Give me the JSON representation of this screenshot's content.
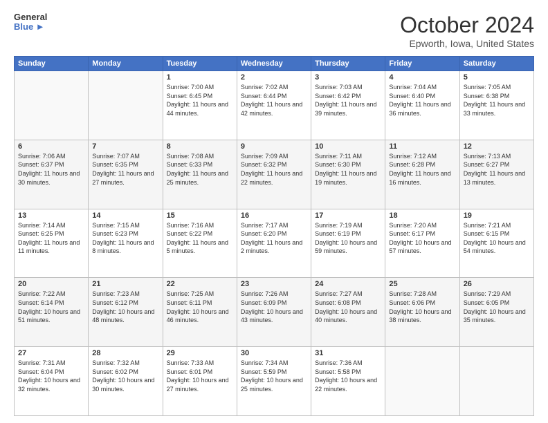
{
  "header": {
    "logo_line1": "General",
    "logo_line2": "Blue",
    "month": "October 2024",
    "location": "Epworth, Iowa, United States"
  },
  "weekdays": [
    "Sunday",
    "Monday",
    "Tuesday",
    "Wednesday",
    "Thursday",
    "Friday",
    "Saturday"
  ],
  "weeks": [
    [
      {
        "day": "",
        "sunrise": "",
        "sunset": "",
        "daylight": ""
      },
      {
        "day": "",
        "sunrise": "",
        "sunset": "",
        "daylight": ""
      },
      {
        "day": "1",
        "sunrise": "Sunrise: 7:00 AM",
        "sunset": "Sunset: 6:45 PM",
        "daylight": "Daylight: 11 hours and 44 minutes."
      },
      {
        "day": "2",
        "sunrise": "Sunrise: 7:02 AM",
        "sunset": "Sunset: 6:44 PM",
        "daylight": "Daylight: 11 hours and 42 minutes."
      },
      {
        "day": "3",
        "sunrise": "Sunrise: 7:03 AM",
        "sunset": "Sunset: 6:42 PM",
        "daylight": "Daylight: 11 hours and 39 minutes."
      },
      {
        "day": "4",
        "sunrise": "Sunrise: 7:04 AM",
        "sunset": "Sunset: 6:40 PM",
        "daylight": "Daylight: 11 hours and 36 minutes."
      },
      {
        "day": "5",
        "sunrise": "Sunrise: 7:05 AM",
        "sunset": "Sunset: 6:38 PM",
        "daylight": "Daylight: 11 hours and 33 minutes."
      }
    ],
    [
      {
        "day": "6",
        "sunrise": "Sunrise: 7:06 AM",
        "sunset": "Sunset: 6:37 PM",
        "daylight": "Daylight: 11 hours and 30 minutes."
      },
      {
        "day": "7",
        "sunrise": "Sunrise: 7:07 AM",
        "sunset": "Sunset: 6:35 PM",
        "daylight": "Daylight: 11 hours and 27 minutes."
      },
      {
        "day": "8",
        "sunrise": "Sunrise: 7:08 AM",
        "sunset": "Sunset: 6:33 PM",
        "daylight": "Daylight: 11 hours and 25 minutes."
      },
      {
        "day": "9",
        "sunrise": "Sunrise: 7:09 AM",
        "sunset": "Sunset: 6:32 PM",
        "daylight": "Daylight: 11 hours and 22 minutes."
      },
      {
        "day": "10",
        "sunrise": "Sunrise: 7:11 AM",
        "sunset": "Sunset: 6:30 PM",
        "daylight": "Daylight: 11 hours and 19 minutes."
      },
      {
        "day": "11",
        "sunrise": "Sunrise: 7:12 AM",
        "sunset": "Sunset: 6:28 PM",
        "daylight": "Daylight: 11 hours and 16 minutes."
      },
      {
        "day": "12",
        "sunrise": "Sunrise: 7:13 AM",
        "sunset": "Sunset: 6:27 PM",
        "daylight": "Daylight: 11 hours and 13 minutes."
      }
    ],
    [
      {
        "day": "13",
        "sunrise": "Sunrise: 7:14 AM",
        "sunset": "Sunset: 6:25 PM",
        "daylight": "Daylight: 11 hours and 11 minutes."
      },
      {
        "day": "14",
        "sunrise": "Sunrise: 7:15 AM",
        "sunset": "Sunset: 6:23 PM",
        "daylight": "Daylight: 11 hours and 8 minutes."
      },
      {
        "day": "15",
        "sunrise": "Sunrise: 7:16 AM",
        "sunset": "Sunset: 6:22 PM",
        "daylight": "Daylight: 11 hours and 5 minutes."
      },
      {
        "day": "16",
        "sunrise": "Sunrise: 7:17 AM",
        "sunset": "Sunset: 6:20 PM",
        "daylight": "Daylight: 11 hours and 2 minutes."
      },
      {
        "day": "17",
        "sunrise": "Sunrise: 7:19 AM",
        "sunset": "Sunset: 6:19 PM",
        "daylight": "Daylight: 10 hours and 59 minutes."
      },
      {
        "day": "18",
        "sunrise": "Sunrise: 7:20 AM",
        "sunset": "Sunset: 6:17 PM",
        "daylight": "Daylight: 10 hours and 57 minutes."
      },
      {
        "day": "19",
        "sunrise": "Sunrise: 7:21 AM",
        "sunset": "Sunset: 6:15 PM",
        "daylight": "Daylight: 10 hours and 54 minutes."
      }
    ],
    [
      {
        "day": "20",
        "sunrise": "Sunrise: 7:22 AM",
        "sunset": "Sunset: 6:14 PM",
        "daylight": "Daylight: 10 hours and 51 minutes."
      },
      {
        "day": "21",
        "sunrise": "Sunrise: 7:23 AM",
        "sunset": "Sunset: 6:12 PM",
        "daylight": "Daylight: 10 hours and 48 minutes."
      },
      {
        "day": "22",
        "sunrise": "Sunrise: 7:25 AM",
        "sunset": "Sunset: 6:11 PM",
        "daylight": "Daylight: 10 hours and 46 minutes."
      },
      {
        "day": "23",
        "sunrise": "Sunrise: 7:26 AM",
        "sunset": "Sunset: 6:09 PM",
        "daylight": "Daylight: 10 hours and 43 minutes."
      },
      {
        "day": "24",
        "sunrise": "Sunrise: 7:27 AM",
        "sunset": "Sunset: 6:08 PM",
        "daylight": "Daylight: 10 hours and 40 minutes."
      },
      {
        "day": "25",
        "sunrise": "Sunrise: 7:28 AM",
        "sunset": "Sunset: 6:06 PM",
        "daylight": "Daylight: 10 hours and 38 minutes."
      },
      {
        "day": "26",
        "sunrise": "Sunrise: 7:29 AM",
        "sunset": "Sunset: 6:05 PM",
        "daylight": "Daylight: 10 hours and 35 minutes."
      }
    ],
    [
      {
        "day": "27",
        "sunrise": "Sunrise: 7:31 AM",
        "sunset": "Sunset: 6:04 PM",
        "daylight": "Daylight: 10 hours and 32 minutes."
      },
      {
        "day": "28",
        "sunrise": "Sunrise: 7:32 AM",
        "sunset": "Sunset: 6:02 PM",
        "daylight": "Daylight: 10 hours and 30 minutes."
      },
      {
        "day": "29",
        "sunrise": "Sunrise: 7:33 AM",
        "sunset": "Sunset: 6:01 PM",
        "daylight": "Daylight: 10 hours and 27 minutes."
      },
      {
        "day": "30",
        "sunrise": "Sunrise: 7:34 AM",
        "sunset": "Sunset: 5:59 PM",
        "daylight": "Daylight: 10 hours and 25 minutes."
      },
      {
        "day": "31",
        "sunrise": "Sunrise: 7:36 AM",
        "sunset": "Sunset: 5:58 PM",
        "daylight": "Daylight: 10 hours and 22 minutes."
      },
      {
        "day": "",
        "sunrise": "",
        "sunset": "",
        "daylight": ""
      },
      {
        "day": "",
        "sunrise": "",
        "sunset": "",
        "daylight": ""
      }
    ]
  ]
}
